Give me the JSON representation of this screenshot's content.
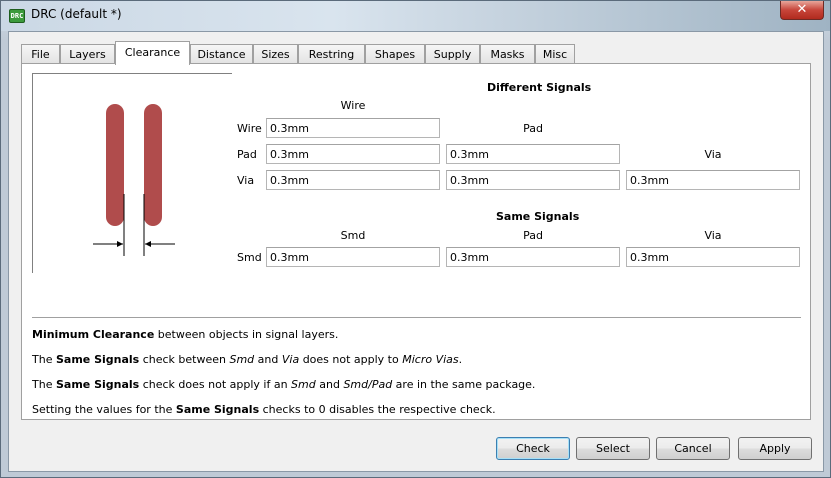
{
  "window": {
    "title": "DRC (default *)",
    "icon_label": "DRC",
    "close_glyph": "✕"
  },
  "tabs": [
    {
      "label": "File"
    },
    {
      "label": "Layers"
    },
    {
      "label": "Clearance",
      "active": true
    },
    {
      "label": "Distance"
    },
    {
      "label": "Sizes"
    },
    {
      "label": "Restring"
    },
    {
      "label": "Shapes"
    },
    {
      "label": "Supply"
    },
    {
      "label": "Masks"
    },
    {
      "label": "Misc"
    }
  ],
  "clearance": {
    "different_signals": {
      "heading": "Different Signals",
      "col_wire": "Wire",
      "col_pad": "Pad",
      "col_via": "Via",
      "row_wire": "Wire",
      "row_pad": "Pad",
      "row_via": "Via",
      "wire_wire": "0.3mm",
      "pad_wire": "0.3mm",
      "pad_pad": "0.3mm",
      "via_wire": "0.3mm",
      "via_pad": "0.3mm",
      "via_via": "0.3mm"
    },
    "same_signals": {
      "heading": "Same Signals",
      "col_smd": "Smd",
      "col_pad": "Pad",
      "col_via": "Via",
      "row_smd": "Smd",
      "smd_smd": "0.3mm",
      "smd_pad": "0.3mm",
      "smd_via": "0.3mm"
    }
  },
  "notes": {
    "line1_bold": "Minimum Clearance",
    "line1_rest": " between objects in signal layers.",
    "line2_a": "The ",
    "line2_bold": "Same Signals",
    "line2_b": " check between ",
    "line2_i1": "Smd",
    "line2_c": " and ",
    "line2_i2": "Via",
    "line2_d": " does not apply to ",
    "line2_i3": "Micro Vias",
    "line2_e": ".",
    "line3_a": "The ",
    "line3_bold": "Same Signals",
    "line3_b": " check does not apply if an ",
    "line3_i1": "Smd",
    "line3_c": " and ",
    "line3_i2": "Smd/Pad",
    "line3_d": " are in the same package.",
    "line4_a": "Setting the values for the ",
    "line4_bold": "Same Signals",
    "line4_b": " checks to 0 disables the respective check."
  },
  "buttons": {
    "check": "Check",
    "select": "Select",
    "cancel": "Cancel",
    "apply": "Apply"
  },
  "colors": {
    "trace_fill": "#b04c4c",
    "dimension_line": "#000000"
  }
}
